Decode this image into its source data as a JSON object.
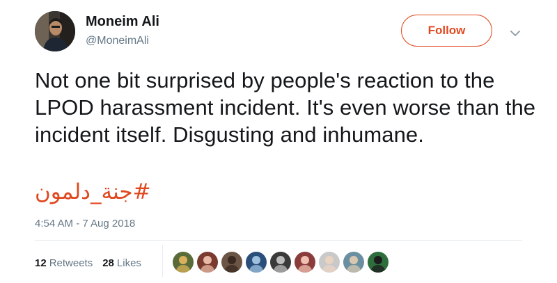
{
  "author": {
    "display_name": "Moneim Ali",
    "handle": "@MoneimAli",
    "avatar_icon": "profile-photo"
  },
  "actions": {
    "follow_label": "Follow",
    "caret_icon": "chevron-down-icon"
  },
  "tweet": {
    "text": "Not one bit surprised by people's reaction to the LPOD harassment incident. It's even worse than the incident itself. Disgusting and inhumane.",
    "hashtag": "#جنة_دلمون",
    "timestamp": "4:54 AM - 7 Aug 2018"
  },
  "stats": {
    "retweets_count": "12",
    "retweets_label": "Retweets",
    "likes_count": "28",
    "likes_label": "Likes"
  },
  "likers": [
    {
      "name": "liker-avatar-1",
      "bg": "#5a6b3a",
      "fg": "#d9b15a"
    },
    {
      "name": "liker-avatar-2",
      "bg": "#7a3a2e",
      "fg": "#e8b9a6"
    },
    {
      "name": "liker-avatar-3",
      "bg": "#6b5545",
      "fg": "#3a2a20"
    },
    {
      "name": "liker-avatar-4",
      "bg": "#2a4f7a",
      "fg": "#9fc1e0"
    },
    {
      "name": "liker-avatar-5",
      "bg": "#3a3a3a",
      "fg": "#bdbdbd"
    },
    {
      "name": "liker-avatar-6",
      "bg": "#8a3b3b",
      "fg": "#f0c0b0"
    },
    {
      "name": "liker-avatar-7",
      "bg": "#c9c9c9",
      "fg": "#e9d3c1"
    },
    {
      "name": "liker-avatar-8",
      "bg": "#6a8fa0",
      "fg": "#d8c8b0"
    },
    {
      "name": "liker-avatar-9",
      "bg": "#2e6e3c",
      "fg": "#1c1c1c"
    }
  ],
  "colors": {
    "accent": "#e0481f",
    "muted": "#657786",
    "text": "#14171a"
  }
}
